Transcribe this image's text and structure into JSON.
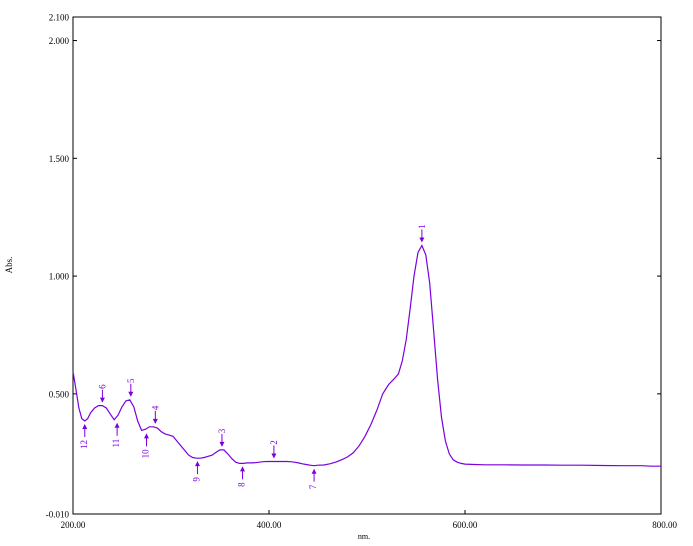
{
  "chart_data": {
    "type": "line",
    "xlabel": "nm.",
    "ylabel": "Abs.",
    "xlim": [
      200,
      800
    ],
    "ylim": [
      -0.01,
      2.1
    ],
    "grid": false,
    "x_ticks": [
      {
        "value": 200,
        "label": "200.00"
      },
      {
        "value": 400,
        "label": "400.00"
      },
      {
        "value": 600,
        "label": "600.00"
      },
      {
        "value": 800,
        "label": "800.00"
      }
    ],
    "y_ticks": [
      {
        "value": -0.01,
        "label": "-0.010"
      },
      {
        "value": 0.5,
        "label": "0.500"
      },
      {
        "value": 1.0,
        "label": "1.000"
      },
      {
        "value": 1.5,
        "label": "1.500"
      },
      {
        "value": 2.0,
        "label": "2.000"
      },
      {
        "value": 2.1,
        "label": "2.100"
      }
    ],
    "colors": {
      "line": "#7b00e0",
      "marker": "#7b00e0",
      "axis": "#000000"
    },
    "series": [
      {
        "x": [
          200,
          203,
          206,
          209,
          212,
          215,
          218,
          222,
          226,
          230,
          234,
          238,
          242,
          246,
          250,
          254,
          258,
          262,
          266,
          270,
          274,
          278,
          282,
          286,
          290,
          294,
          298,
          302,
          306,
          310,
          314,
          318,
          322,
          326,
          330,
          334,
          338,
          342,
          346,
          350,
          354,
          358,
          362,
          366,
          370,
          374,
          378,
          382,
          386,
          390,
          394,
          398,
          402,
          406,
          410,
          414,
          418,
          422,
          426,
          430,
          434,
          438,
          442,
          446,
          450,
          456,
          462,
          468,
          474,
          480,
          486,
          492,
          498,
          504,
          510,
          516,
          522,
          528,
          532,
          536,
          540,
          544,
          548,
          552,
          556,
          560,
          564,
          568,
          572,
          576,
          580,
          584,
          588,
          592,
          596,
          600,
          610,
          620,
          640,
          660,
          680,
          700,
          720,
          740,
          760,
          780,
          790,
          800
        ],
        "y": [
          0.595,
          0.52,
          0.44,
          0.395,
          0.385,
          0.395,
          0.42,
          0.44,
          0.45,
          0.45,
          0.44,
          0.415,
          0.39,
          0.41,
          0.445,
          0.47,
          0.475,
          0.445,
          0.385,
          0.345,
          0.35,
          0.36,
          0.36,
          0.355,
          0.34,
          0.33,
          0.325,
          0.32,
          0.3,
          0.28,
          0.26,
          0.24,
          0.23,
          0.227,
          0.227,
          0.23,
          0.235,
          0.24,
          0.252,
          0.262,
          0.262,
          0.245,
          0.225,
          0.21,
          0.205,
          0.205,
          0.207,
          0.207,
          0.208,
          0.21,
          0.212,
          0.213,
          0.213,
          0.213,
          0.213,
          0.213,
          0.213,
          0.212,
          0.21,
          0.207,
          0.203,
          0.2,
          0.197,
          0.195,
          0.197,
          0.198,
          0.203,
          0.21,
          0.22,
          0.232,
          0.25,
          0.28,
          0.32,
          0.37,
          0.43,
          0.5,
          0.54,
          0.565,
          0.585,
          0.64,
          0.73,
          0.86,
          1.0,
          1.1,
          1.13,
          1.09,
          0.97,
          0.77,
          0.56,
          0.4,
          0.3,
          0.245,
          0.22,
          0.21,
          0.205,
          0.202,
          0.2,
          0.199,
          0.199,
          0.198,
          0.198,
          0.197,
          0.197,
          0.196,
          0.195,
          0.195,
          0.193,
          0.193
        ]
      }
    ],
    "peaks": [
      {
        "label": "1",
        "x": 556,
        "y": 1.13,
        "kind": "peak"
      },
      {
        "label": "2",
        "x": 405,
        "y": 0.213,
        "kind": "peak"
      },
      {
        "label": "3",
        "x": 352,
        "y": 0.262,
        "kind": "peak"
      },
      {
        "label": "4",
        "x": 284,
        "y": 0.36,
        "kind": "peak"
      },
      {
        "label": "5",
        "x": 259,
        "y": 0.475,
        "kind": "peak"
      },
      {
        "label": "6",
        "x": 230,
        "y": 0.45,
        "kind": "peak"
      },
      {
        "label": "7",
        "x": 446,
        "y": 0.195,
        "kind": "valley"
      },
      {
        "label": "8",
        "x": 373,
        "y": 0.205,
        "kind": "valley"
      },
      {
        "label": "9",
        "x": 327,
        "y": 0.227,
        "kind": "valley"
      },
      {
        "label": "10",
        "x": 275,
        "y": 0.345,
        "kind": "valley"
      },
      {
        "label": "11",
        "x": 245,
        "y": 0.39,
        "kind": "valley"
      },
      {
        "label": "12",
        "x": 212,
        "y": 0.385,
        "kind": "valley"
      }
    ]
  }
}
